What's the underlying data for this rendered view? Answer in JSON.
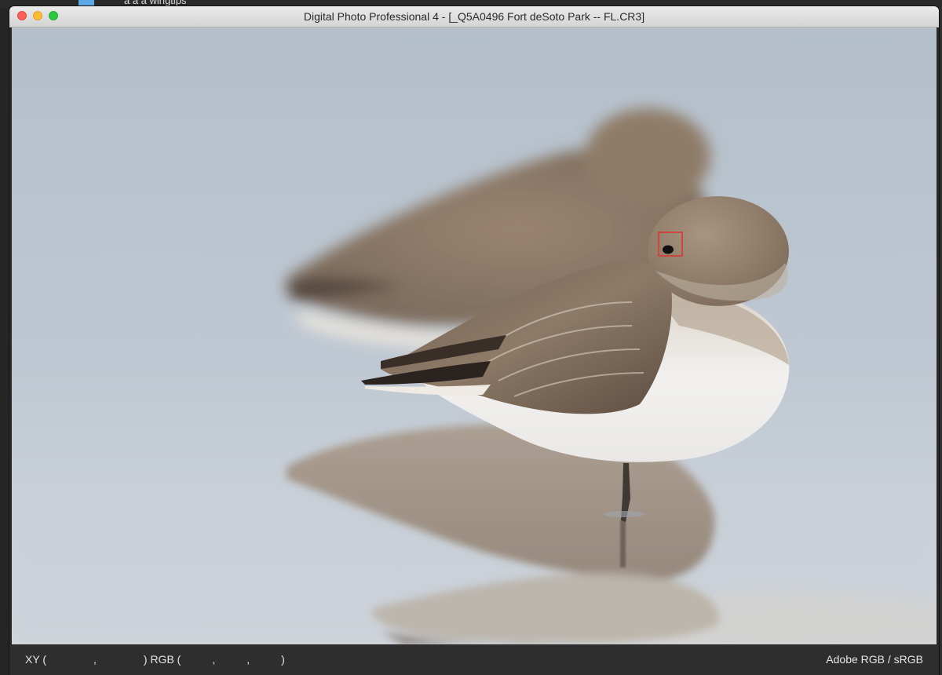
{
  "desktop": {
    "folder_label": "a a a wingtips"
  },
  "window": {
    "title": "Digital Photo Professional 4 - [_Q5A0496 Fort deSoto Park -- FL.CR3]"
  },
  "statusbar": {
    "xy_label": "XY (",
    "xy_comma": ",",
    "xy_close": ")",
    "rgb_label": "RGB (",
    "rgb_comma1": ",",
    "rgb_comma2": ",",
    "rgb_close": ")",
    "color_space": "Adobe RGB / sRGB"
  },
  "colors": {
    "water_top": "#b9c3ce",
    "water_bottom": "#cfd5dd",
    "bird_brown": "#8c7a66",
    "bird_belly": "#efefee",
    "af_point": "#e0302a"
  }
}
